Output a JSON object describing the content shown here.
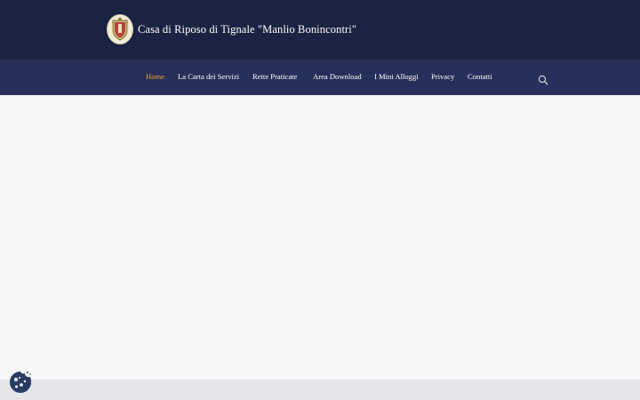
{
  "header": {
    "site_title": "Casa di Riposo di Tignale \"Manlio Bonincontri\"",
    "logo_icon": "crest-icon"
  },
  "nav": {
    "items": [
      {
        "label": "Home",
        "active": true
      },
      {
        "label": "La Carta dei Servizi",
        "active": false
      },
      {
        "label": "Rette Praticate",
        "active": false
      },
      {
        "label": "Area Download",
        "active": false
      },
      {
        "label": "I Mini Alloggi",
        "active": false
      },
      {
        "label": "Privacy",
        "active": false
      },
      {
        "label": "Contatti",
        "active": false
      }
    ],
    "search_icon": "search-icon"
  },
  "cookie": {
    "icon": "cookie-icon"
  },
  "colors": {
    "topbar": "#1b2342",
    "navbar": "#27305a",
    "active": "#e8a23a",
    "background": "#f6f6f6",
    "footer": "#e4e6ea",
    "cookie": "#2a3b63"
  }
}
